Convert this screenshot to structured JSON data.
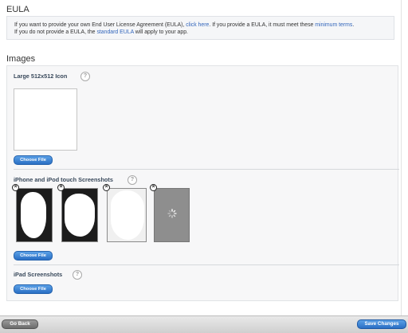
{
  "eula": {
    "title": "EULA",
    "line1_a": "If you want to provide your own End User License Agreement (EULA), ",
    "line1_link1": "click here",
    "line1_b": ". If you provide a EULA, it must meet these ",
    "line1_link2": "minimum terms",
    "line1_c": ".",
    "line2_a": "If you do not provide a EULA, the ",
    "line2_link": "standard EULA",
    "line2_b": " will apply to your app."
  },
  "images": {
    "title": "Images",
    "large_icon": {
      "label": "Large 512x512 Icon",
      "button": "Choose File"
    },
    "iphone": {
      "label": "iPhone and iPod touch Screenshots",
      "button": "Choose File"
    },
    "ipad": {
      "label": "iPad Screenshots",
      "button": "Choose File"
    },
    "help_glyph": "?",
    "delete_glyph": "×"
  },
  "footer": {
    "back": "Go Back",
    "save": "Save Changes"
  },
  "colors": {
    "link": "#3366bb",
    "accent_button": "#2a6fc4",
    "section_label": "#3a4a5c"
  }
}
